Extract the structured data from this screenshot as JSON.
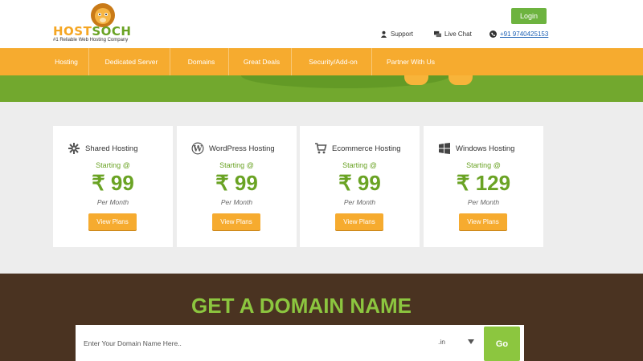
{
  "header": {
    "logo_text_a": "HOST",
    "logo_text_b": "SOCH",
    "tagline": "#1 Reliable Web Hosting Company",
    "login_label": "Login",
    "support_label": "Support",
    "chat_label": "Live Chat",
    "phone": "+91 9740425153"
  },
  "nav": {
    "items": [
      {
        "label": "Hosting"
      },
      {
        "label": "Dedicated Server"
      },
      {
        "label": "Domains"
      },
      {
        "label": "Great Deals"
      },
      {
        "label": "Security/Add-on"
      },
      {
        "label": "Partner With Us"
      }
    ]
  },
  "plans": [
    {
      "title": "Shared Hosting",
      "icon": "gear-icon",
      "starting": "Starting @",
      "price": "₹ 99",
      "period": "Per Month",
      "button": "View Plans"
    },
    {
      "title": "WordPress Hosting",
      "icon": "wordpress-icon",
      "starting": "Starting @",
      "price": "₹ 99",
      "period": "Per Month",
      "button": "View Plans"
    },
    {
      "title": "Ecommerce Hosting",
      "icon": "cart-icon",
      "starting": "Starting @",
      "price": "₹ 99",
      "period": "Per Month",
      "button": "View Plans"
    },
    {
      "title": "Windows Hosting",
      "icon": "windows-icon",
      "starting": "Starting @",
      "price": "₹ 129",
      "period": "Per Month",
      "button": "View Plans"
    }
  ],
  "domain": {
    "title": "GET A DOMAIN NAME",
    "placeholder": "Enter Your Domain Name Here..",
    "tld": ".in",
    "go_label": "Go"
  },
  "colors": {
    "orange": "#f6ab2f",
    "green": "#6aa324",
    "brown": "#4a3321"
  }
}
